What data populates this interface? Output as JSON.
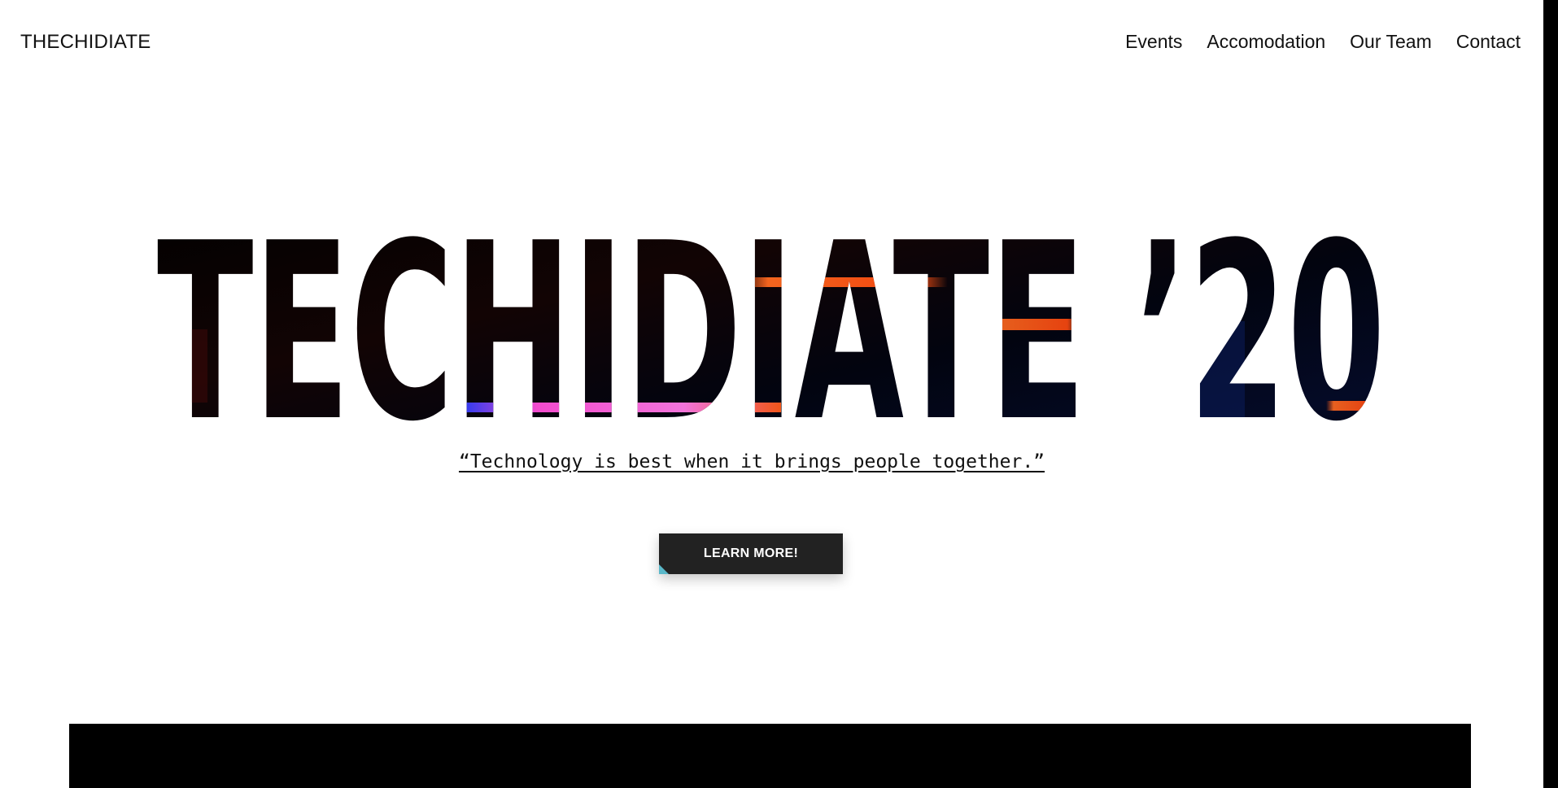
{
  "navbar": {
    "brand": "THECHIDIATE",
    "links": [
      "Events",
      "Accomodation",
      "Our Team",
      "Contact"
    ]
  },
  "hero": {
    "title": "TECHIDIATE ’20",
    "quote": "“Technology is best when it brings people together.”",
    "cta_label": "LEARN MORE!"
  },
  "colors": {
    "background": "#ffffff",
    "text": "#111111",
    "button_bg": "#222222",
    "button_accent": "#5ab8c9",
    "band": "#000000",
    "title_glow_orange": "#ff5a1a",
    "title_glow_pink": "#ff4fd8",
    "title_glow_blue": "#1a3cff"
  }
}
